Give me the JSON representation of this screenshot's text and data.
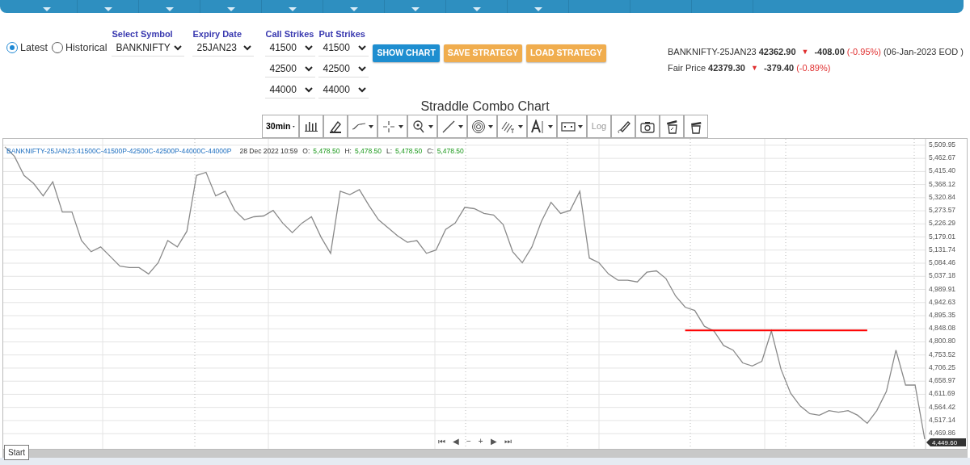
{
  "mode_options": [
    {
      "label": "Latest",
      "selected": true
    },
    {
      "label": "Historical",
      "selected": false
    }
  ],
  "symbol": {
    "label": "Select Symbol",
    "value": "BANKNIFTY"
  },
  "expiry": {
    "label": "Expiry Date",
    "value": "25JAN23"
  },
  "call_strikes": {
    "label": "Call Strikes",
    "values": [
      "41500",
      "42500",
      "44000"
    ]
  },
  "put_strikes": {
    "label": "Put Strikes",
    "values": [
      "41500",
      "42500",
      "44000"
    ]
  },
  "buttons": [
    {
      "label": "SHOW CHART",
      "kind": "primary"
    },
    {
      "label": "SAVE STRATEGY",
      "kind": "warning"
    },
    {
      "label": "LOAD STRATEGY",
      "kind": "warning"
    }
  ],
  "quotes": [
    {
      "label": "BANKNIFTY-25JAN23",
      "price": "42362.90",
      "arrow": "▼",
      "change": "-408.00",
      "percent": "(-0.95%)",
      "note": "(06-Jan-2023 EOD )"
    },
    {
      "label": "Fair Price",
      "price": "42379.30",
      "arrow": "▼",
      "change": "-379.40",
      "percent": "(-0.89%)"
    }
  ],
  "chart_title": "Straddle Combo Chart",
  "toolbar": [
    {
      "kind": "select",
      "label": "30min"
    },
    {
      "kind": "icon",
      "dropdown": false
    },
    {
      "kind": "icon",
      "dropdown": false
    },
    {
      "kind": "icon",
      "dropdown": true
    },
    {
      "kind": "icon",
      "dropdown": true
    },
    {
      "kind": "icon",
      "dropdown": true
    },
    {
      "kind": "icon",
      "dropdown": true
    },
    {
      "kind": "icon",
      "dropdown": true
    },
    {
      "kind": "icon",
      "dropdown": true
    },
    {
      "kind": "icon",
      "dropdown": true
    },
    {
      "kind": "icon",
      "dropdown": true
    },
    {
      "kind": "text",
      "label": "Log"
    },
    {
      "kind": "icon",
      "dropdown": false
    },
    {
      "kind": "icon",
      "dropdown": false
    },
    {
      "kind": "icon",
      "dropdown": false
    },
    {
      "kind": "icon",
      "dropdown": false
    }
  ],
  "legend": {
    "time": "28 Dec 2022 10:59",
    "ohlc": [
      {
        "key": "O:",
        "value": "5,478.50"
      },
      {
        "key": "H:",
        "value": "5,478.50"
      },
      {
        "key": "L:",
        "value": "5,478.50"
      },
      {
        "key": "C:",
        "value": "5,478.50"
      }
    ]
  },
  "chart_data": {
    "type": "line",
    "grid": true,
    "ylim": [
      4415,
      5532.9
    ],
    "yticks": [
      {
        "value": 5509.95,
        "label": "5,509.95"
      },
      {
        "value": 5462.67,
        "label": "5,462.67"
      },
      {
        "value": 5415.4,
        "label": "5,415.40"
      },
      {
        "value": 5368.12,
        "label": "5,368.12"
      },
      {
        "value": 5320.84,
        "label": "5,320.84"
      },
      {
        "value": 5273.57,
        "label": "5,273.57"
      },
      {
        "value": 5226.29,
        "label": "5,226.29"
      },
      {
        "value": 5179.01,
        "label": "5,179.01"
      },
      {
        "value": 5131.74,
        "label": "5,131.74"
      },
      {
        "value": 5084.46,
        "label": "5,084.46"
      },
      {
        "value": 5037.18,
        "label": "5,037.18"
      },
      {
        "value": 4989.91,
        "label": "4,989.91"
      },
      {
        "value": 4942.63,
        "label": "4,942.63"
      },
      {
        "value": 4895.35,
        "label": "4,895.35"
      },
      {
        "value": 4848.08,
        "label": "4,848.08"
      },
      {
        "value": 4800.8,
        "label": "4,800.80"
      },
      {
        "value": 4753.52,
        "label": "4,753.52"
      },
      {
        "value": 4706.25,
        "label": "4,706.25"
      },
      {
        "value": 4658.97,
        "label": "4,658.97"
      },
      {
        "value": 4611.69,
        "label": "4,611.69"
      },
      {
        "value": 4564.42,
        "label": "4,564.42"
      },
      {
        "value": 4517.14,
        "label": "4,517.14"
      },
      {
        "value": 4469.86,
        "label": "4,469.86"
      }
    ],
    "series": [
      {
        "name": "BANKNIFTY-25JAN23:41500C-41500P-42500C-42500P-44000C-44000P",
        "color": "#8a8a8a",
        "values": [
          5504,
          5470,
          5401,
          5372,
          5327,
          5378,
          5269,
          5269,
          5166,
          5126,
          5143,
          5109,
          5074,
          5069,
          5069,
          5046,
          5086,
          5166,
          5143,
          5200,
          5401,
          5412,
          5327,
          5344,
          5275,
          5241,
          5252,
          5255,
          5275,
          5229,
          5195,
          5229,
          5252,
          5178,
          5120,
          5344,
          5332,
          5350,
          5292,
          5241,
          5212,
          5183,
          5160,
          5166,
          5120,
          5132,
          5206,
          5229,
          5286,
          5281,
          5264,
          5258,
          5224,
          5126,
          5086,
          5143,
          5235,
          5304,
          5264,
          5275,
          5344,
          5103,
          5086,
          5046,
          5023,
          5023,
          5017,
          5052,
          5057,
          5029,
          4966,
          4926,
          4914,
          4857,
          4840,
          4788,
          4771,
          4725,
          4714,
          4731,
          4840,
          4702,
          4616,
          4570,
          4542,
          4536,
          4553,
          4547,
          4553,
          4536,
          4507,
          4553,
          4622,
          4771,
          4645,
          4645,
          4450
        ]
      },
      {
        "color": "#ff0000",
        "values": [
          null,
          null,
          null,
          null,
          null,
          null,
          null,
          null,
          null,
          null,
          null,
          null,
          null,
          null,
          null,
          null,
          null,
          null,
          null,
          null,
          null,
          null,
          null,
          null,
          null,
          null,
          null,
          null,
          null,
          null,
          null,
          null,
          null,
          null,
          null,
          null,
          null,
          null,
          null,
          null,
          null,
          null,
          null,
          null,
          null,
          null,
          null,
          null,
          null,
          null,
          null,
          null,
          null,
          null,
          null,
          null,
          null,
          null,
          null,
          null,
          null,
          null,
          null,
          null,
          null,
          null,
          null,
          null,
          null,
          null,
          null,
          4842,
          4842,
          4842,
          4842,
          4842,
          4842,
          4842,
          4842,
          4842,
          4842,
          4842,
          4842,
          4842,
          4842,
          4842,
          4842,
          4842,
          4842,
          4842,
          4842,
          null,
          null,
          null,
          null,
          null,
          null
        ]
      }
    ]
  },
  "last_price_label": "4,449.60",
  "navigation": [
    "⏮",
    "◀",
    "−",
    "+",
    "▶",
    "⏭"
  ],
  "tooltip": "Start"
}
